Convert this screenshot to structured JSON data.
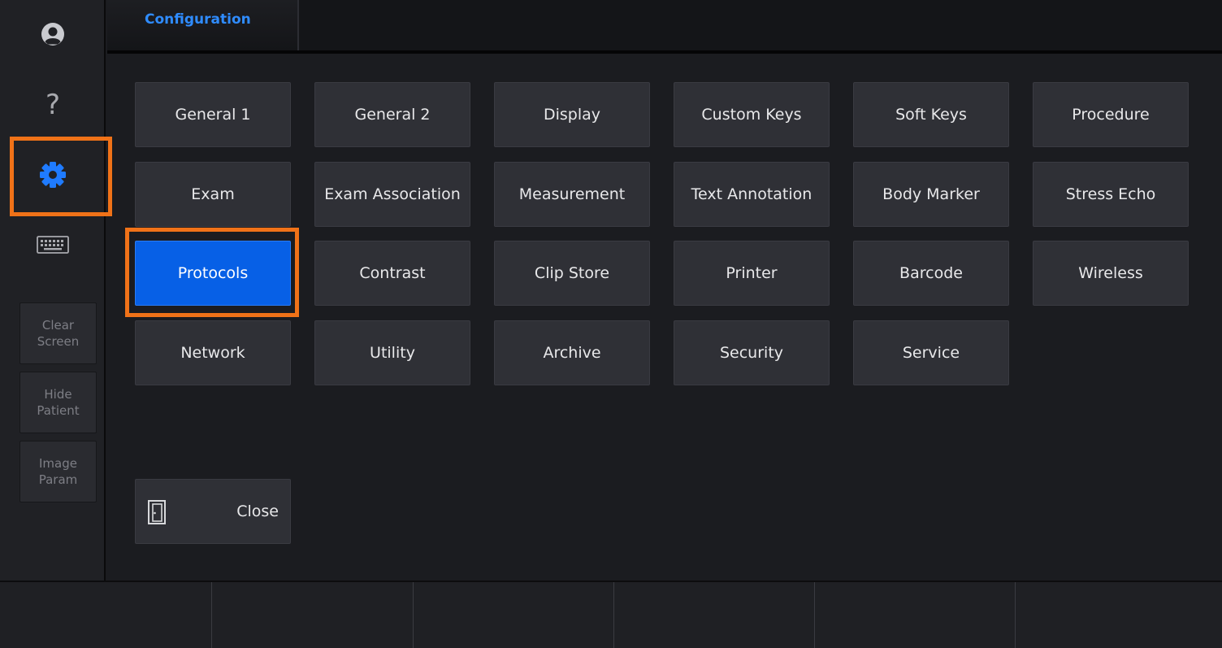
{
  "sidebar": {
    "icons": [
      "user-icon",
      "help-icon",
      "gear-icon",
      "keyboard-icon"
    ],
    "help_glyph": "?",
    "buttons": [
      {
        "label": "Clear\nScreen"
      },
      {
        "label": "Hide\nPatient"
      },
      {
        "label": "Image\nParam"
      }
    ]
  },
  "tabs": [
    {
      "label": "Configuration"
    }
  ],
  "grid": [
    [
      "General 1",
      "General 2",
      "Display",
      "Custom Keys",
      "Soft Keys",
      "Procedure"
    ],
    [
      "Exam",
      "Exam Association",
      "Measurement",
      "Text Annotation",
      "Body Marker",
      "Stress Echo"
    ],
    [
      "Protocols",
      "Contrast",
      "Clip Store",
      "Printer",
      "Barcode",
      "Wireless"
    ],
    [
      "Network",
      "Utility",
      "Archive",
      "Security",
      "Service"
    ]
  ],
  "active_item": "Protocols",
  "close_button": {
    "label": "Close",
    "icon": "door-icon"
  },
  "colors": {
    "accent": "#0760e6",
    "tab_text": "#2f8cff",
    "gear_icon": "#1f7bff",
    "highlight": "#f07218"
  }
}
